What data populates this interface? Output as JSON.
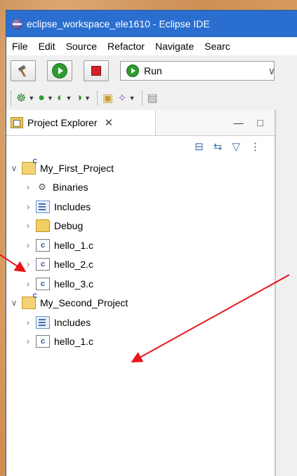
{
  "window": {
    "title": "eclipse_workspace_ele1610 - Eclipse IDE"
  },
  "menubar": [
    "File",
    "Edit",
    "Source",
    "Refactor",
    "Navigate",
    "Searc"
  ],
  "toolbar": {
    "run_config": "Run"
  },
  "panel": {
    "tab_label": "Project Explorer"
  },
  "tree": [
    {
      "label": "My_First_Project",
      "level": 0,
      "expanded": true,
      "icon": "project-icon"
    },
    {
      "label": "Binaries",
      "level": 1,
      "icon": "binaries-icon"
    },
    {
      "label": "Includes",
      "level": 1,
      "icon": "includes-icon"
    },
    {
      "label": "Debug",
      "level": 1,
      "icon": "folder-icon"
    },
    {
      "label": "hello_1.c",
      "level": 1,
      "icon": "c-file-icon"
    },
    {
      "label": "hello_2.c",
      "level": 1,
      "icon": "c-file-icon"
    },
    {
      "label": "hello_3.c",
      "level": 1,
      "icon": "c-file-icon"
    },
    {
      "label": "My_Second_Project",
      "level": 0,
      "expanded": true,
      "icon": "project-icon"
    },
    {
      "label": "Includes",
      "level": 1,
      "icon": "includes-icon"
    },
    {
      "label": "hello_1.c",
      "level": 1,
      "icon": "c-file-icon"
    }
  ],
  "annotation_color": "#e8141c"
}
